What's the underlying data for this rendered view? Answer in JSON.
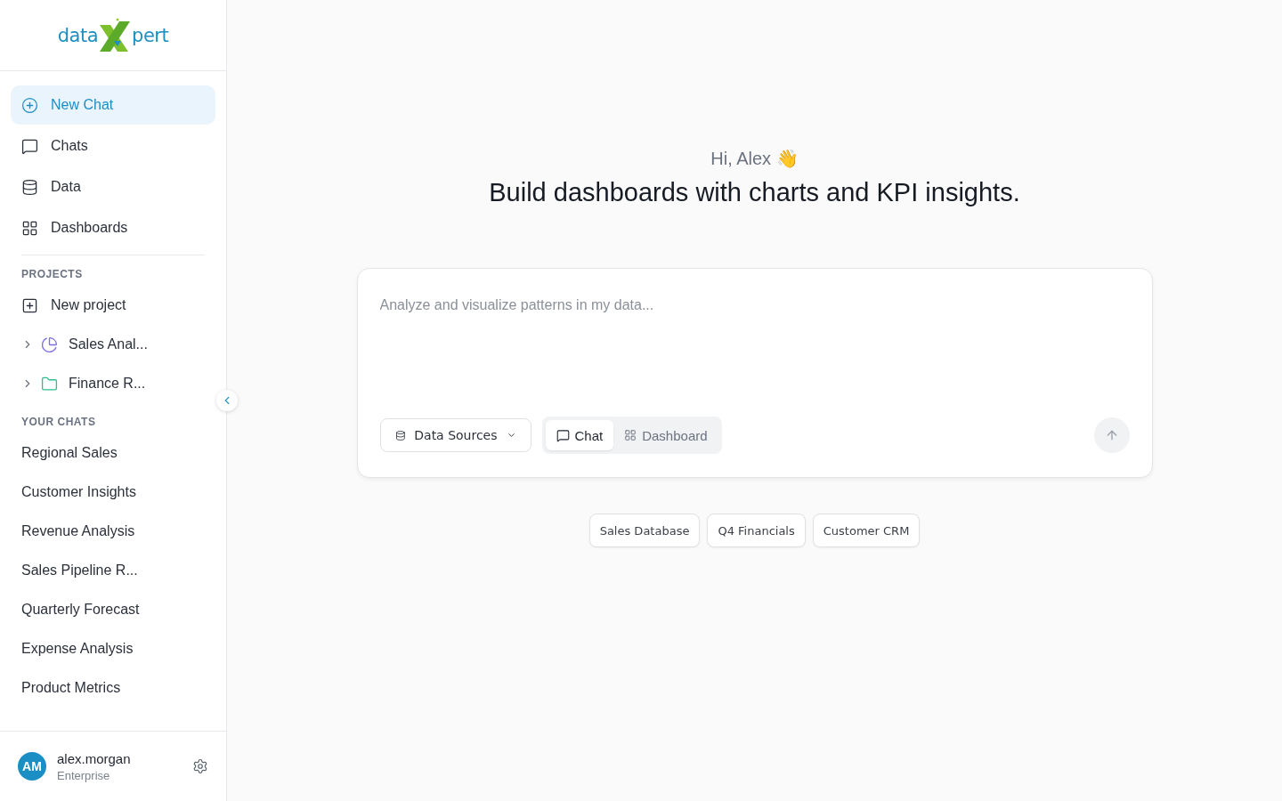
{
  "logo": {
    "left": "data",
    "right": "pert"
  },
  "nav": [
    {
      "label": "New Chat",
      "kind": "new",
      "selected": true
    },
    {
      "label": "Chats",
      "kind": "chat",
      "selected": false
    },
    {
      "label": "Data",
      "kind": "data",
      "selected": false
    },
    {
      "label": "Dashboards",
      "kind": "grid",
      "selected": false
    }
  ],
  "projects": {
    "heading": "PROJECTS",
    "new_label": "New project",
    "items": [
      {
        "label": "Sales Anal...",
        "kind": "pie",
        "color": "#7c6fe0",
        "expanded": false
      },
      {
        "label": "Finance R...",
        "kind": "folder",
        "color": "#2fbf8f",
        "expanded": false
      }
    ]
  },
  "chats": {
    "heading": "YOUR CHATS",
    "items": [
      "Regional Sales",
      "Customer Insights",
      "Revenue Analysis",
      "Sales Pipeline R...",
      "Quarterly Forecast",
      "Expense Analysis",
      "Product Metrics"
    ]
  },
  "user": {
    "initials": "AM",
    "name": "alex.morgan",
    "plan": "Enterprise"
  },
  "greeting": "Hi, Alex 👋",
  "headline": "Build dashboards with charts and KPI insights.",
  "prompt": {
    "placeholder": "Analyze and visualize patterns in my data...",
    "sources_label": "Data Sources",
    "modes": [
      {
        "label": "Chat",
        "kind": "chat",
        "selected": true
      },
      {
        "label": "Dashboard",
        "kind": "grid",
        "selected": false
      }
    ]
  },
  "suggestions": [
    "Sales Database",
    "Q4 Financials",
    "Customer CRM"
  ]
}
